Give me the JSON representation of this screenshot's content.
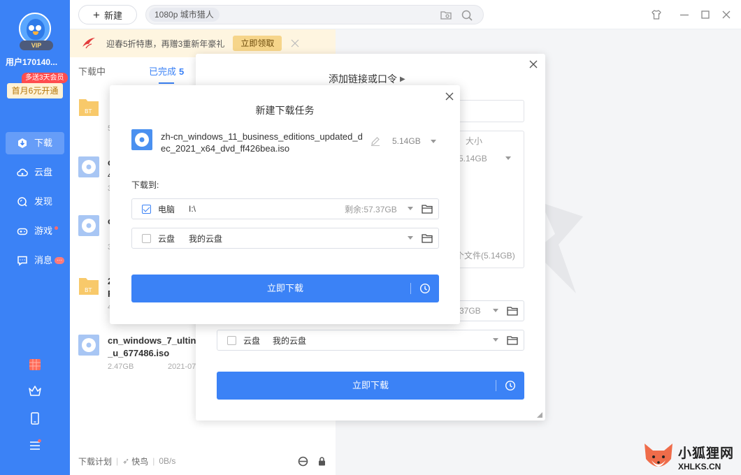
{
  "sidebar": {
    "vip_label": "VIP",
    "username": "用户170140...",
    "promo_badge": "多送3天会员",
    "promo_button": "首月6元开通",
    "nav": [
      {
        "label": "下载",
        "icon": "download-icon"
      },
      {
        "label": "云盘",
        "icon": "cloud-icon"
      },
      {
        "label": "发现",
        "icon": "discover-icon"
      },
      {
        "label": "游戏",
        "icon": "gamepad-icon"
      },
      {
        "label": "消息",
        "icon": "message-icon"
      }
    ],
    "bottom_icons": [
      "apps-icon",
      "crown-icon",
      "phone-icon",
      "menu-icon"
    ]
  },
  "topbar": {
    "new_label": "新建",
    "search_value": "1080p 城市猎人",
    "icons": [
      "folder-search-icon",
      "search-icon",
      "skin-icon",
      "minimize-icon",
      "maximize-icon",
      "close-icon"
    ]
  },
  "banner": {
    "text": "迎春5折特惠，再赠3重新年豪礼",
    "button": "立即领取"
  },
  "tabs": [
    {
      "label": "下载中",
      "count": ""
    },
    {
      "label": "已完成",
      "count": "5"
    }
  ],
  "files": [
    {
      "type": "folder",
      "name": "",
      "meta": "",
      "date": ""
    },
    {
      "type": "iso",
      "name": "c",
      "line2": "4",
      "meta": "3",
      "date": ""
    },
    {
      "type": "iso",
      "name": "c",
      "line2": "",
      "meta": "3",
      "date": ""
    },
    {
      "type": "folder",
      "name": "2",
      "line2": "F",
      "meta": "4",
      "date": ""
    },
    {
      "type": "iso",
      "name": "cn_windows_7_ultin",
      "line2": "_u_677486.iso",
      "meta": "2.47GB",
      "date": "2021-07"
    }
  ],
  "footer": {
    "plan": "下载计划",
    "speed_label": "快鸟",
    "speed": "0B/s"
  },
  "back_dialog": {
    "title": "添加链接或口令",
    "size_header": "大小",
    "size_value": "5.14GB",
    "summary": "个文件(5.14GB)",
    "pc_free": "37GB",
    "cloud_label": "云盘",
    "cloud_path": "我的云盘",
    "download_button": "立即下载"
  },
  "main_dialog": {
    "title": "新建下载任务",
    "file_name": "zh-cn_windows_11_business_editions_updated_dec_2021_x64_dvd_ff426bea.iso",
    "file_size": "5.14GB",
    "download_to": "下载到:",
    "pc": {
      "label": "电脑",
      "path": "I:\\",
      "free": "剩余:57.37GB",
      "checked": true
    },
    "cloud": {
      "label": "云盘",
      "path": "我的云盘",
      "checked": false
    },
    "download_button": "立即下载"
  },
  "watermark": {
    "cn": "小狐狸网",
    "en": "XHLKS.CN"
  }
}
